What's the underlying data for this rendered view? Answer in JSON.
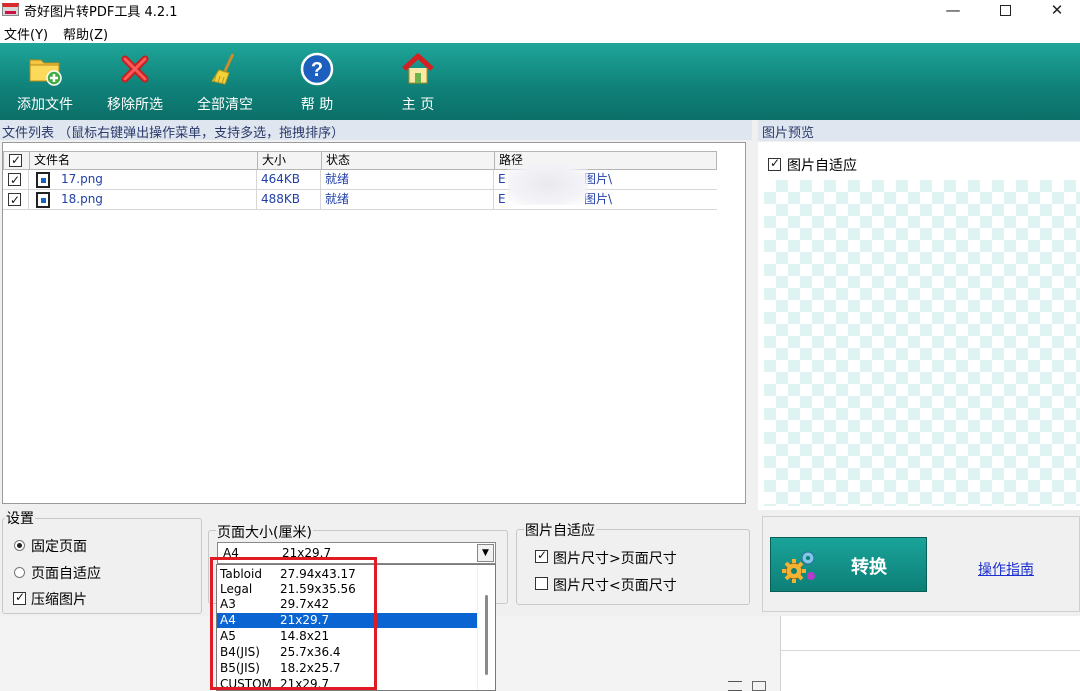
{
  "window": {
    "title": "奇好图片转PDF工具 4.2.1",
    "minimize": "—",
    "close": "✕"
  },
  "menu": [
    "文件(Y)",
    "帮助(Z)"
  ],
  "toolbar": {
    "add_files": "添加文件",
    "remove_selected": "移除所选",
    "clear_all": "全部清空",
    "help": "帮 助",
    "home": "主 页"
  },
  "file_list": {
    "header": "文件列表  （鼠标右键弹出操作菜单，支持多选，拖拽排序）",
    "columns": [
      "文件名",
      "大小",
      "状态",
      "路径"
    ],
    "rows": [
      {
        "name": "17.png",
        "size": "464KB",
        "status": "就绪",
        "path_start": "E",
        "path_end": "图片\\",
        "checked": true
      },
      {
        "name": "18.png",
        "size": "488KB",
        "status": "就绪",
        "path_start": "E",
        "path_end": "图片\\",
        "checked": true
      }
    ]
  },
  "preview": {
    "header": "图片预览",
    "fit_label": "图片自适应",
    "fit_checked": true
  },
  "settings": {
    "title": "设置",
    "fixed_page": "固定页面",
    "adaptive_page": "页面自适应",
    "compress": "压缩图片",
    "page_mode": "fixed",
    "compress_checked": true
  },
  "page_size": {
    "title": "页面大小(厘米)",
    "selected_name": "A4",
    "selected_value": "21x29.7",
    "options": [
      {
        "name": "Tabloid",
        "value": "27.94x43.17"
      },
      {
        "name": "Legal",
        "value": "21.59x35.56"
      },
      {
        "name": "A3",
        "value": "29.7x42"
      },
      {
        "name": "A4",
        "value": "21x29.7"
      },
      {
        "name": "A5",
        "value": "14.8x21"
      },
      {
        "name": "B4(JIS)",
        "value": "25.7x36.4"
      },
      {
        "name": "B5(JIS)",
        "value": "18.2x25.7"
      },
      {
        "name": "CUSTOM",
        "value": "21x29.7"
      }
    ]
  },
  "image_fit": {
    "title": "图片自适应",
    "larger": "图片尺寸>页面尺寸",
    "smaller": "图片尺寸<页面尺寸",
    "larger_checked": true,
    "smaller_checked": false
  },
  "convert": {
    "button": "转换",
    "guide": "操作指南"
  },
  "colors": {
    "toolbar": "#10837a",
    "selection": "#0a64d2",
    "highlight": "#e01b24"
  }
}
